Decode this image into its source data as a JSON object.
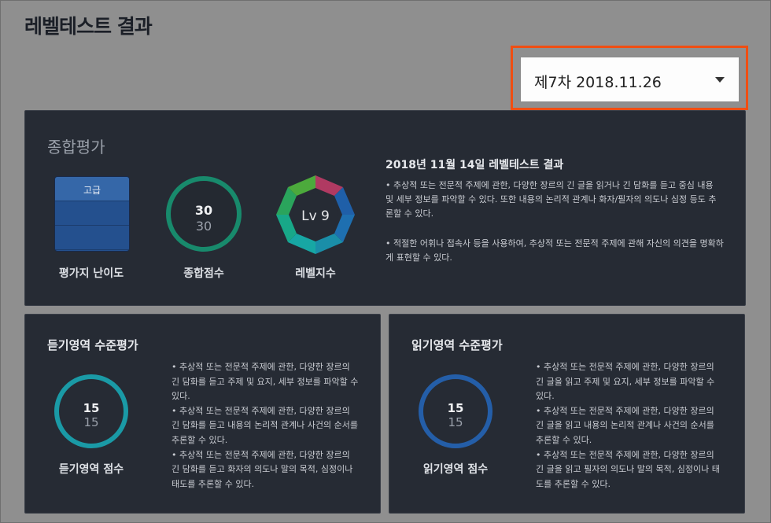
{
  "page": {
    "title": "레벨테스트 결과"
  },
  "session_select": {
    "value": "제7차 2018.11.26"
  },
  "summary": {
    "title": "종합평가",
    "difficulty": {
      "level": "고급",
      "caption": "평가지 난이도"
    },
    "total": {
      "score": "30",
      "max": "30",
      "caption": "종합점수"
    },
    "level_index": {
      "value": "Lv 9",
      "caption": "레벨지수"
    },
    "result_title": "2018년 11월 14일 레벨테스트 결과",
    "result_paragraphs": [
      "• 추상적 또는 전문적 주제에 관한, 다양한 장르의 긴 글을 읽거나 긴 담화를 듣고 중심 내용 및 세부 정보를 파악할 수 있다. 또한 내용의 논리적 관계나 화자/필자의 의도나 심정 등도 추론할 수 있다.",
      "• 적절한 어휘나 접속사 등을 사용하여, 추상적 또는 전문적 주제에 관해 자신의 의견을 명확하게 표현할 수 있다."
    ]
  },
  "listening": {
    "title": "듣기영역 수준평가",
    "score": "15",
    "max": "15",
    "caption": "듣기영역 점수",
    "text": "• 추상적 또는 전문적 주제에 관한, 다양한 장르의 긴 담화를 듣고 주제 및 요지, 세부 정보를 파악할 수 있다.\n• 추상적 또는 전문적 주제에 관한, 다양한 장르의 긴 담화를 듣고 내용의 논리적 관계나 사건의 순서를 추론할 수 있다.\n• 추상적 또는 전문적 주제에 관한, 다양한 장르의 긴 담화를 듣고 화자의 의도나 말의 목적, 심정이나 태도를 추론할 수 있다."
  },
  "reading": {
    "title": "읽기영역 수준평가",
    "score": "15",
    "max": "15",
    "caption": "읽기영역 점수",
    "text": "• 추상적 또는 전문적 주제에 관한, 다양한 장르의 긴 글을 읽고 주제 및 요지, 세부 정보를 파악할 수 있다.\n• 추상적 또는 전문적 주제에 관한, 다양한 장르의 긴 글을 읽고 내용의 논리적 관계나 사건의 순서를 추론할 수 있다.\n• 추상적 또는 전문적 주제에 관한, 다양한 장르의 긴 글을 읽고 필자의 의도나 말의 목적, 심정이나 태도를 추론할 수 있다."
  },
  "colors": {
    "accent_highlight": "#f04e12",
    "total_ring": "#188a6c",
    "listen_ring": "#1a9aa6",
    "read_ring": "#245ea8"
  }
}
